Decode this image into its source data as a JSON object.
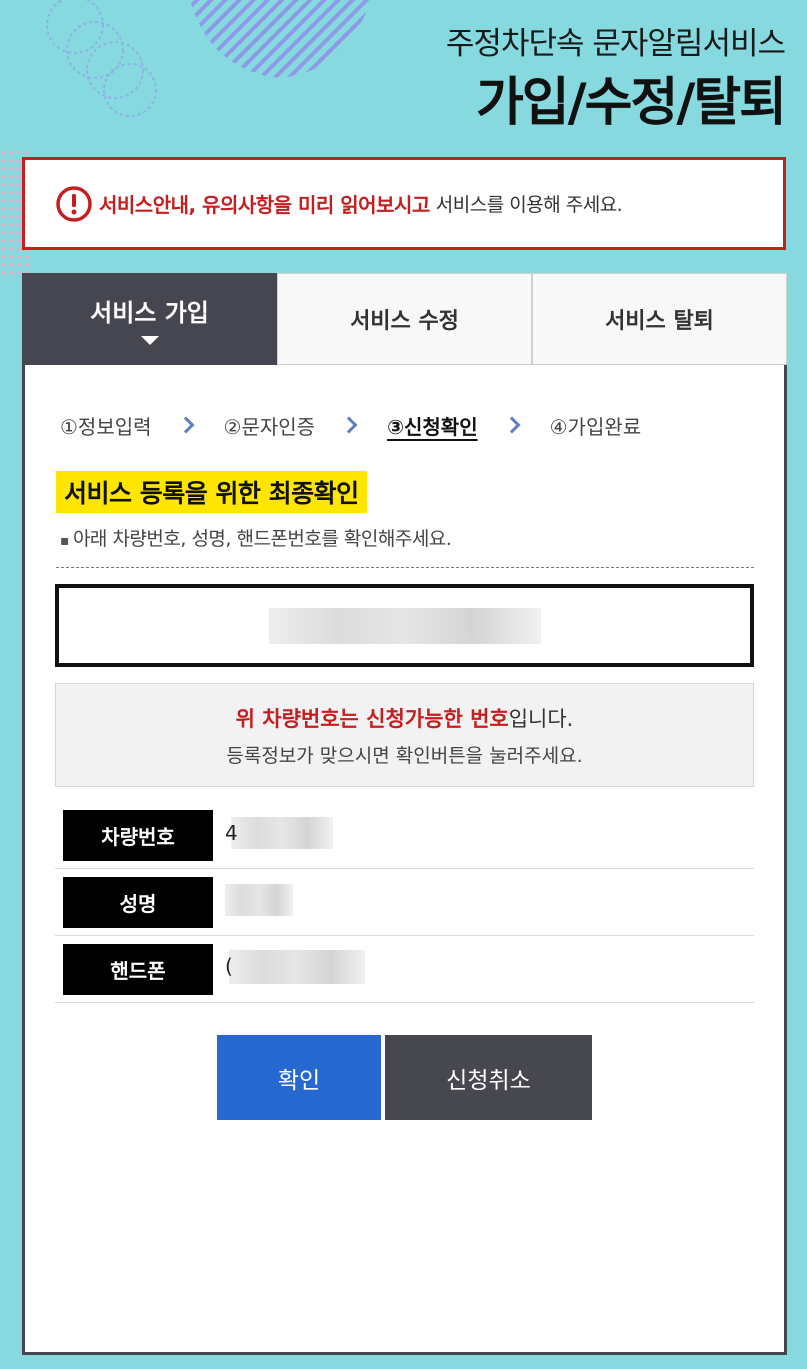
{
  "header": {
    "subtitle": "주정차단속 문자알림서비스",
    "title": "가입/수정/탈퇴"
  },
  "notice": {
    "icon": "exclamation-circle-icon",
    "strong_text": "서비스안내, 유의사항을 미리 읽어보시고",
    "normal_text": "서비스를 이용해 주세요.",
    "color": "#c41e1e"
  },
  "tabs": [
    {
      "label": "서비스 가입",
      "active": true
    },
    {
      "label": "서비스 수정",
      "active": false
    },
    {
      "label": "서비스 탈퇴",
      "active": false
    }
  ],
  "steps": [
    {
      "label": "①정보입력",
      "current": false
    },
    {
      "label": "②문자인증",
      "current": false
    },
    {
      "label": "③신청확인",
      "current": true
    },
    {
      "label": "④가입완료",
      "current": false
    }
  ],
  "section": {
    "title": "서비스 등록을 위한 최종확인",
    "description": "아래 차량번호, 성명, 핸드폰번호를 확인해주세요."
  },
  "info": {
    "strong_text": "위 차량번호는 신청가능한 번호",
    "normal_suffix": "입니다.",
    "line2": "등록정보가 맞으시면 확인버튼을 눌러주세요."
  },
  "details": [
    {
      "label": "차량번호",
      "value_prefix": "4"
    },
    {
      "label": "성명",
      "value_prefix": ""
    },
    {
      "label": "핸드폰",
      "value_prefix": "("
    }
  ],
  "buttons": {
    "confirm": "확인",
    "cancel": "신청취소"
  },
  "colors": {
    "background": "#86d9df",
    "active_tab": "#464650",
    "highlight": "#ffe600",
    "confirm_button": "#2468d0",
    "cancel_button": "#474750"
  }
}
